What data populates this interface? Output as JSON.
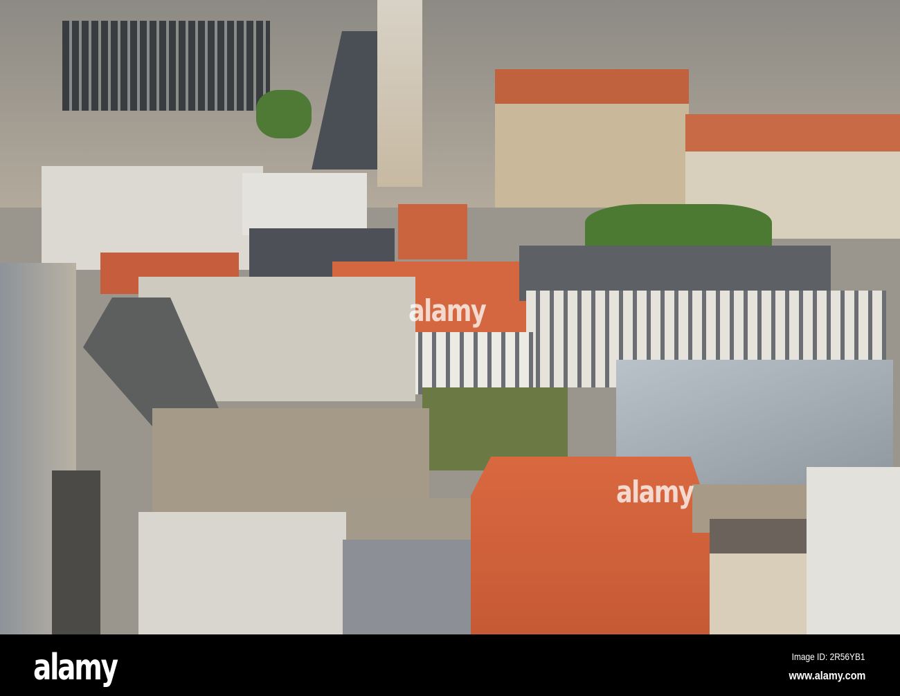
{
  "photo": {
    "watermark_center": "alamy",
    "watermark_right": "alamy"
  },
  "footer": {
    "logo": "alamy",
    "image_id": "Image ID: 2R56YB1",
    "website": "www.alamy.com"
  },
  "colors": {
    "roof_orange": "#d4673f",
    "roof_gray": "#5d6166",
    "wall_white": "#e6e3dc",
    "greenery": "#4f7a35"
  }
}
